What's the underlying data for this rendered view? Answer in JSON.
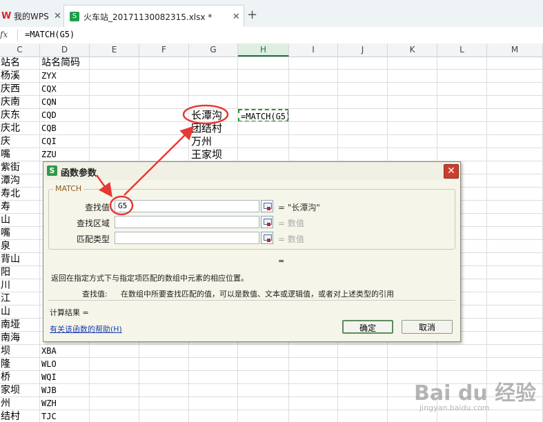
{
  "tabs": [
    {
      "label": "我的WPS"
    },
    {
      "label": "火车站_20171130082315.xlsx *"
    }
  ],
  "new_tab_symbol": "+",
  "close_symbol": "✕",
  "formula_bar": {
    "fx": "fx",
    "formula": "=MATCH(G5)"
  },
  "columns": [
    "C",
    "D",
    "E",
    "F",
    "G",
    "H",
    "I",
    "J",
    "K",
    "L",
    "M"
  ],
  "selected_column": "H",
  "col_c_rows": [
    "站名",
    "杨溪",
    "庆西",
    "庆南",
    "庆东",
    "庆北",
    "庆",
    "嘴",
    "紫街",
    "潭沟",
    "寿北",
    "寿",
    "山",
    "嘴",
    "泉",
    "背山",
    "阳",
    "川",
    "江",
    "山",
    "南垭",
    "南海",
    "坝",
    "隆",
    "桥",
    "家坝",
    "州",
    "结村"
  ],
  "col_d_rows": [
    "站名简码",
    "ZYX",
    "CQX",
    "CQN",
    "CQD",
    "CQB",
    "CQI",
    "ZZU",
    "",
    "",
    "",
    "",
    "",
    "",
    "",
    "",
    "",
    "",
    "",
    "",
    "",
    "",
    "XBA",
    "WLO",
    "WQI",
    "WJB",
    "WZH",
    "TJC"
  ],
  "col_g_rows": [
    "长潭沟",
    "团结村",
    "万州",
    "王家坝"
  ],
  "h_formula": "=MATCH(G5)",
  "dialog": {
    "icon": "S",
    "title": "函数参数",
    "close": "✕",
    "function_name": "MATCH",
    "params": [
      {
        "label": "查找值",
        "value": "G5",
        "result": "= \"长潭沟\"",
        "dim": false
      },
      {
        "label": "查找区域",
        "value": "",
        "result": "= 数值",
        "dim": true
      },
      {
        "label": "匹配类型",
        "value": "",
        "result": "= 数值",
        "dim": true
      }
    ],
    "middle_equals": "=",
    "description": "返回在指定方式下与指定项匹配的数组中元素的相应位置。",
    "arg_label": "查找值:",
    "arg_description": "在数组中所要查找匹配的值，可以是数值、文本或逻辑值，或者对上述类型的引用",
    "calc_result": "计算结果 =",
    "help_link": "有关该函数的帮助(H)",
    "ok_label": "确定",
    "cancel_label": "取消"
  },
  "colors": {
    "annotation": "#e53935",
    "selection": "#217346"
  },
  "watermark": {
    "big": "Bai du 经验",
    "small": "jingyan.baidu.com"
  }
}
